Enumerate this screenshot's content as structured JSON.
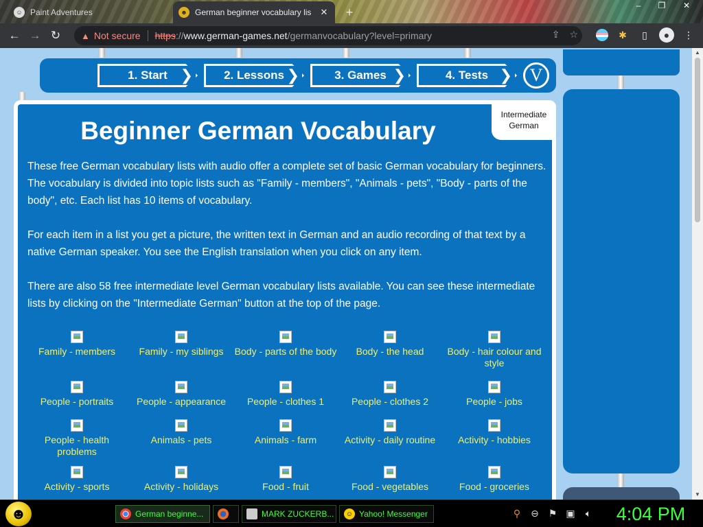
{
  "browser": {
    "tabs": [
      {
        "title": "Paint Adventures",
        "active": false
      },
      {
        "title": "German beginner vocabulary lis",
        "active": true
      }
    ],
    "new_tab": "+",
    "window_controls": [
      "–",
      "❐",
      "✕"
    ],
    "security_label": "Not secure",
    "url": {
      "scheme": "https",
      "slashes": "://",
      "host": "www.german-games.net",
      "path": "/germanvocabulary?level=primary"
    }
  },
  "page": {
    "nav": [
      {
        "label": "1. Start"
      },
      {
        "label": "2. Lessons"
      },
      {
        "label": "3. Games"
      },
      {
        "label": "4. Tests"
      }
    ],
    "v_button": "V",
    "level_tab": "Intermediate German",
    "title": "Beginner German Vocabulary",
    "paragraphs": [
      "These free German vocabulary lists with audio offer a complete set of basic German vocabulary for beginners. The vocabulary is divided into topic lists such as \"Family - members\", \"Animals - pets\", \"Body - parts of the body\", etc. Each list has 10 items of vocabulary.",
      "For each item in a list you get a picture, the written text in German and an audio recording of that text by a native German speaker. You see the English translation when you click on any item.",
      "There are also 58 free intermediate level German vocabulary lists available. You can see these intermediate lists by clicking on the \"Intermediate German\" button at the top of the page."
    ],
    "topics": [
      [
        "Family - members",
        "Family - my siblings",
        "Body - parts of the body",
        "Body - the head",
        "Body - hair colour and style"
      ],
      [
        "People - portraits",
        "People - appearance",
        "People - clothes 1",
        "People - clothes 2",
        "People - jobs"
      ],
      [
        "People - health problems",
        "Animals - pets",
        "Animals - farm",
        "Activity - daily routine",
        "Activity - hobbies"
      ],
      [
        "Activity - sports",
        "Activity - holidays",
        "Food - fruit",
        "Food - vegetables",
        "Food - groceries"
      ]
    ]
  },
  "taskbar": {
    "tasks": [
      {
        "label": "German beginne...",
        "icon": "chrome-icon",
        "active": true
      },
      {
        "label": "",
        "icon": "firefox-icon",
        "active": false
      },
      {
        "label": "MARK ZUCKERB...",
        "icon": "document-icon",
        "active": false
      },
      {
        "label": "Yahoo! Messenger",
        "icon": "yahoo-messenger-icon",
        "active": false
      }
    ],
    "clock": "4:04 PM"
  },
  "colors": {
    "page_blue": "#0b72c0",
    "sky": "#a8d0f0",
    "link_yellow": "#f0f070",
    "taskbar_green": "#3cff3c"
  }
}
